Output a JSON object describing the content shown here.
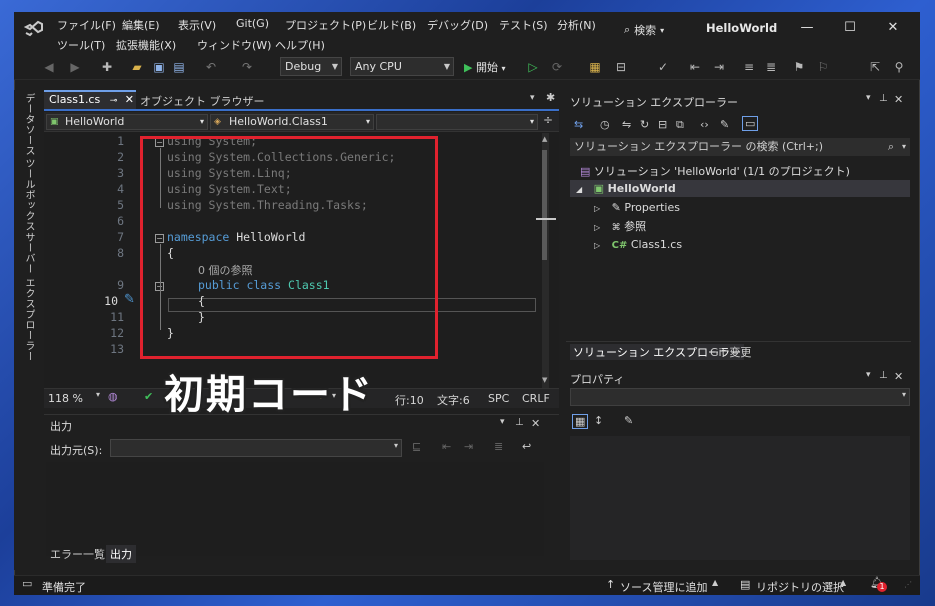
{
  "menu": {
    "row1": [
      "ファイル(F)",
      "編集(E)",
      "表示(V)",
      "Git(G)",
      "プロジェクト(P)",
      "ビルド(B)",
      "デバッグ(D)",
      "テスト(S)",
      "分析(N)"
    ],
    "row2": [
      "ツール(T)",
      "拡張機能(X)",
      "ウィンドウ(W)",
      "ヘルプ(H)"
    ],
    "search_label": "検索",
    "app_title": "HelloWorld"
  },
  "toolbar": {
    "config": "Debug",
    "platform": "Any CPU",
    "start_label": "開始"
  },
  "side_tabs": [
    "データソース",
    "ツールボックス",
    "サーバー エクスプローラー"
  ],
  "editor": {
    "tab_active": "Class1.cs",
    "tab_inactive": "オブジェクト ブラウザー",
    "nav_project": "HelloWorld",
    "nav_class": "HelloWorld.Class1",
    "line_numbers": [
      "1",
      "2",
      "3",
      "4",
      "5",
      "6",
      "7",
      "8",
      "9",
      "10",
      "11",
      "12",
      "13"
    ],
    "lines": {
      "l1a": "using",
      "l1b": " System;",
      "l2a": "using",
      "l2b": " System.Collections.Generic;",
      "l3a": "using",
      "l3b": " System.Linq;",
      "l4a": "using",
      "l4b": " System.Text;",
      "l5a": "using",
      "l5b": " System.Threading.Tasks;",
      "l7a": "namespace",
      "l7b": " HelloWorld",
      "l8": "{",
      "codelens": "0 個の参照",
      "l9a": "public class",
      "l9b": " Class1",
      "l10": "{",
      "l11": "}",
      "l12": "}"
    },
    "zoom": "118 %",
    "row_col": "行:10",
    "char_col": "文字:6",
    "spc": "SPC",
    "crlf": "CRLF"
  },
  "overlay_caption": "初期コード",
  "output": {
    "title": "出力",
    "source_label": "出力元(S):",
    "tab_errors": "エラー一覧",
    "tab_output": "出力"
  },
  "solution_explorer": {
    "title": "ソリューション エクスプローラー",
    "search_placeholder": "ソリューション エクスプローラー の検索 (Ctrl+;)",
    "solution": "ソリューション 'HelloWorld' (1/1 のプロジェクト)",
    "project": "HelloWorld",
    "properties": "Properties",
    "references": "参照",
    "class_file": "Class1.cs",
    "tab_solex": "ソリューション エクスプローラー",
    "tab_git": "Git 変更"
  },
  "properties": {
    "title": "プロパティ"
  },
  "statusbar": {
    "ready": "準備完了",
    "source_control": "ソース管理に追加",
    "repo": "リポジトリの選択",
    "notification_count": "1"
  }
}
